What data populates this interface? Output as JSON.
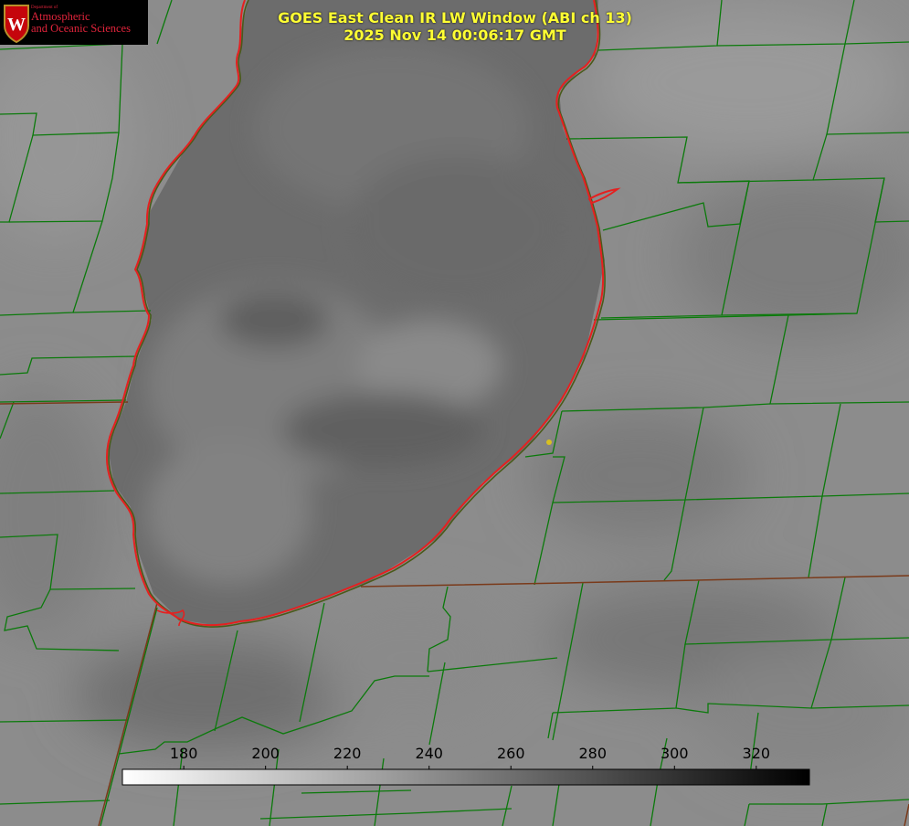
{
  "title": {
    "line1": "GOES East Clean IR LW Window (ABI ch 13)",
    "line2": "2025 Nov 14 00:06:17 GMT"
  },
  "logo": {
    "department": "Department of",
    "line1": "Atmospheric",
    "line2": "and Oceanic Sciences",
    "emblem": "W"
  },
  "colorbar": {
    "ticks": [
      180,
      200,
      220,
      240,
      260,
      280,
      300,
      320
    ],
    "range": [
      165,
      333
    ],
    "colors": {
      "low": "#ffffff",
      "high": "#000000"
    }
  },
  "colors": {
    "county_lines": "#0b7a0b",
    "coastline": "#e02020",
    "state_lines": "#7a3a1a",
    "marker": "#d8c020",
    "title": "#ffff33"
  }
}
